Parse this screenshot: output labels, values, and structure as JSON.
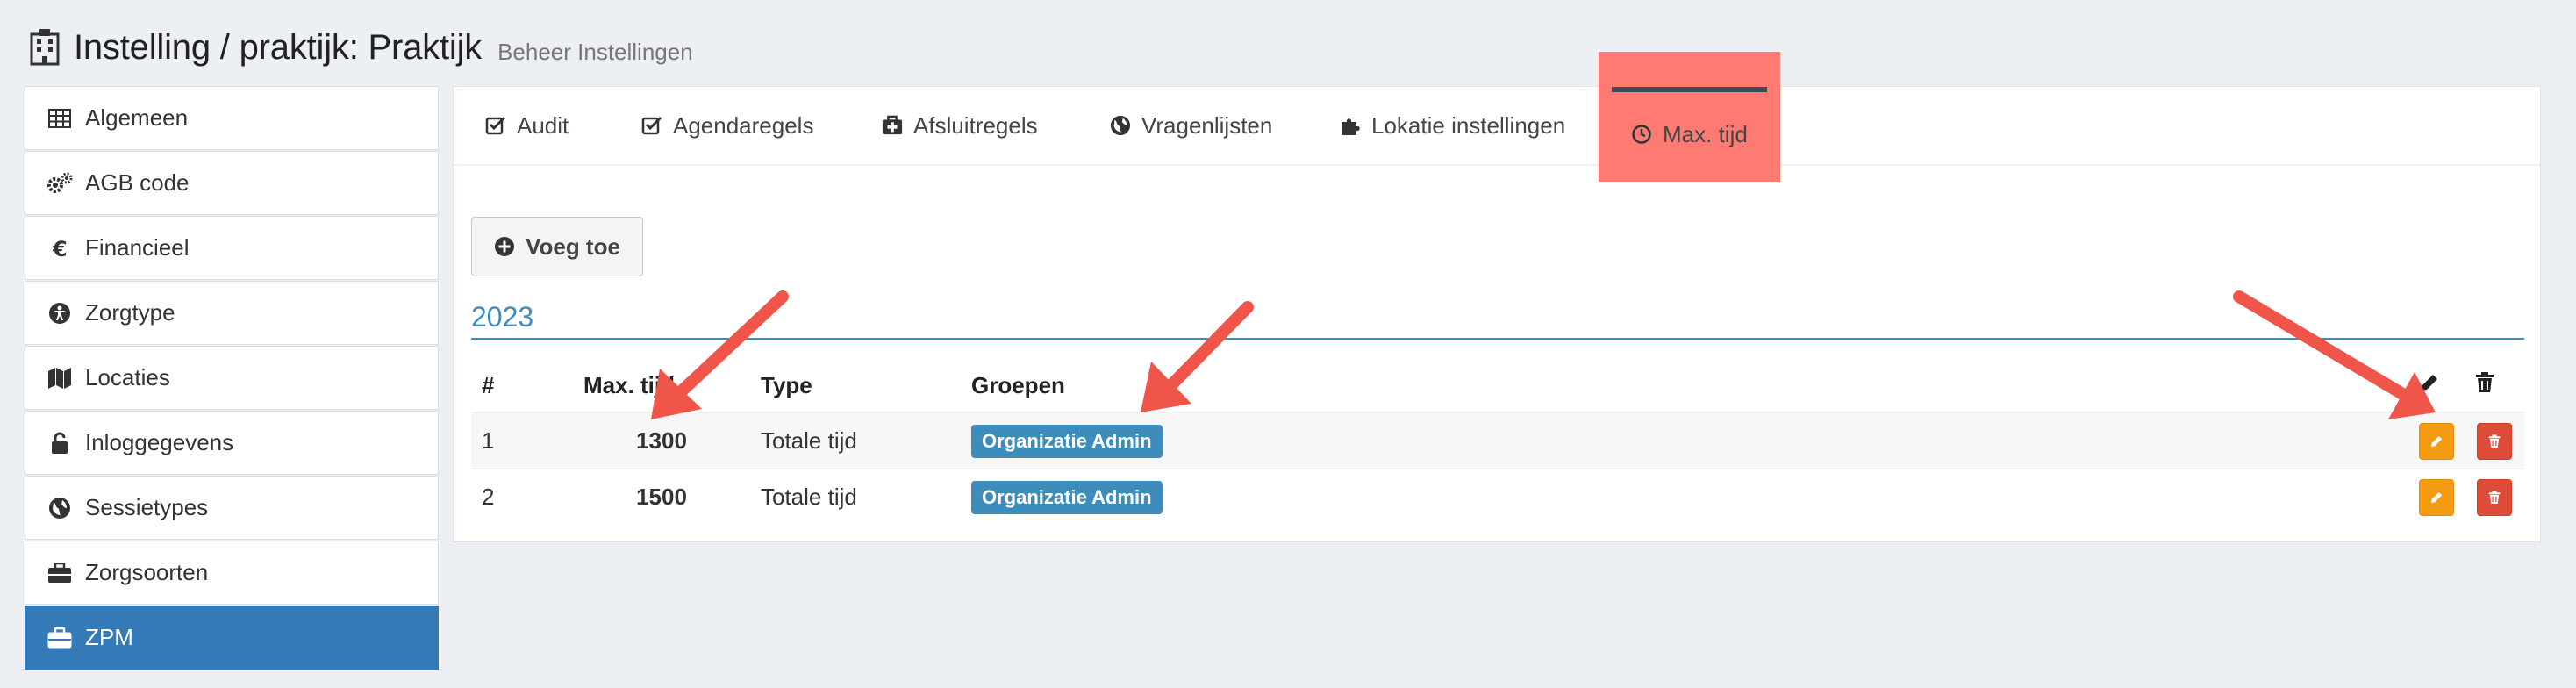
{
  "header": {
    "title": "Instelling / praktijk: Praktijk",
    "subtitle": "Beheer Instellingen"
  },
  "sidebar": {
    "items": [
      {
        "label": "Algemeen",
        "icon": "table-icon"
      },
      {
        "label": "AGB code",
        "icon": "cogs-icon"
      },
      {
        "label": "Financieel",
        "icon": "euro-icon"
      },
      {
        "label": "Zorgtype",
        "icon": "universal-access-icon"
      },
      {
        "label": "Locaties",
        "icon": "map-icon"
      },
      {
        "label": "Inloggegevens",
        "icon": "unlock-icon"
      },
      {
        "label": "Sessietypes",
        "icon": "globe-icon"
      },
      {
        "label": "Zorgsoorten",
        "icon": "briefcase-icon"
      },
      {
        "label": "ZPM",
        "icon": "briefcase-icon",
        "active": true
      }
    ]
  },
  "tabs": [
    {
      "label": "Audit",
      "icon": "check-square-icon"
    },
    {
      "label": "Agendaregels",
      "icon": "check-square-icon"
    },
    {
      "label": "Afsluitregels",
      "icon": "medkit-icon"
    },
    {
      "label": "Vragenlijsten",
      "icon": "globe-icon"
    },
    {
      "label": "Lokatie instellingen",
      "icon": "puzzle-icon"
    },
    {
      "label": "Max. tijd",
      "icon": "clock-icon",
      "active": true
    }
  ],
  "actions": {
    "add_label": "Voeg toe"
  },
  "section": {
    "year": "2023"
  },
  "table": {
    "headers": {
      "num": "#",
      "max": "Max. tijd",
      "type": "Type",
      "groups": "Groepen"
    },
    "rows": [
      {
        "num": "1",
        "max": "1300",
        "type": "Totale tijd",
        "group": "Organizatie Admin"
      },
      {
        "num": "2",
        "max": "1500",
        "type": "Totale tijd",
        "group": "Organizatie Admin"
      }
    ]
  },
  "colors": {
    "primary": "#337ab7",
    "link_blue": "#3c8dbc",
    "highlight": "#ff7a72",
    "edit": "#f39c12",
    "delete": "#dd4b39",
    "arrow": "#f0554a"
  }
}
